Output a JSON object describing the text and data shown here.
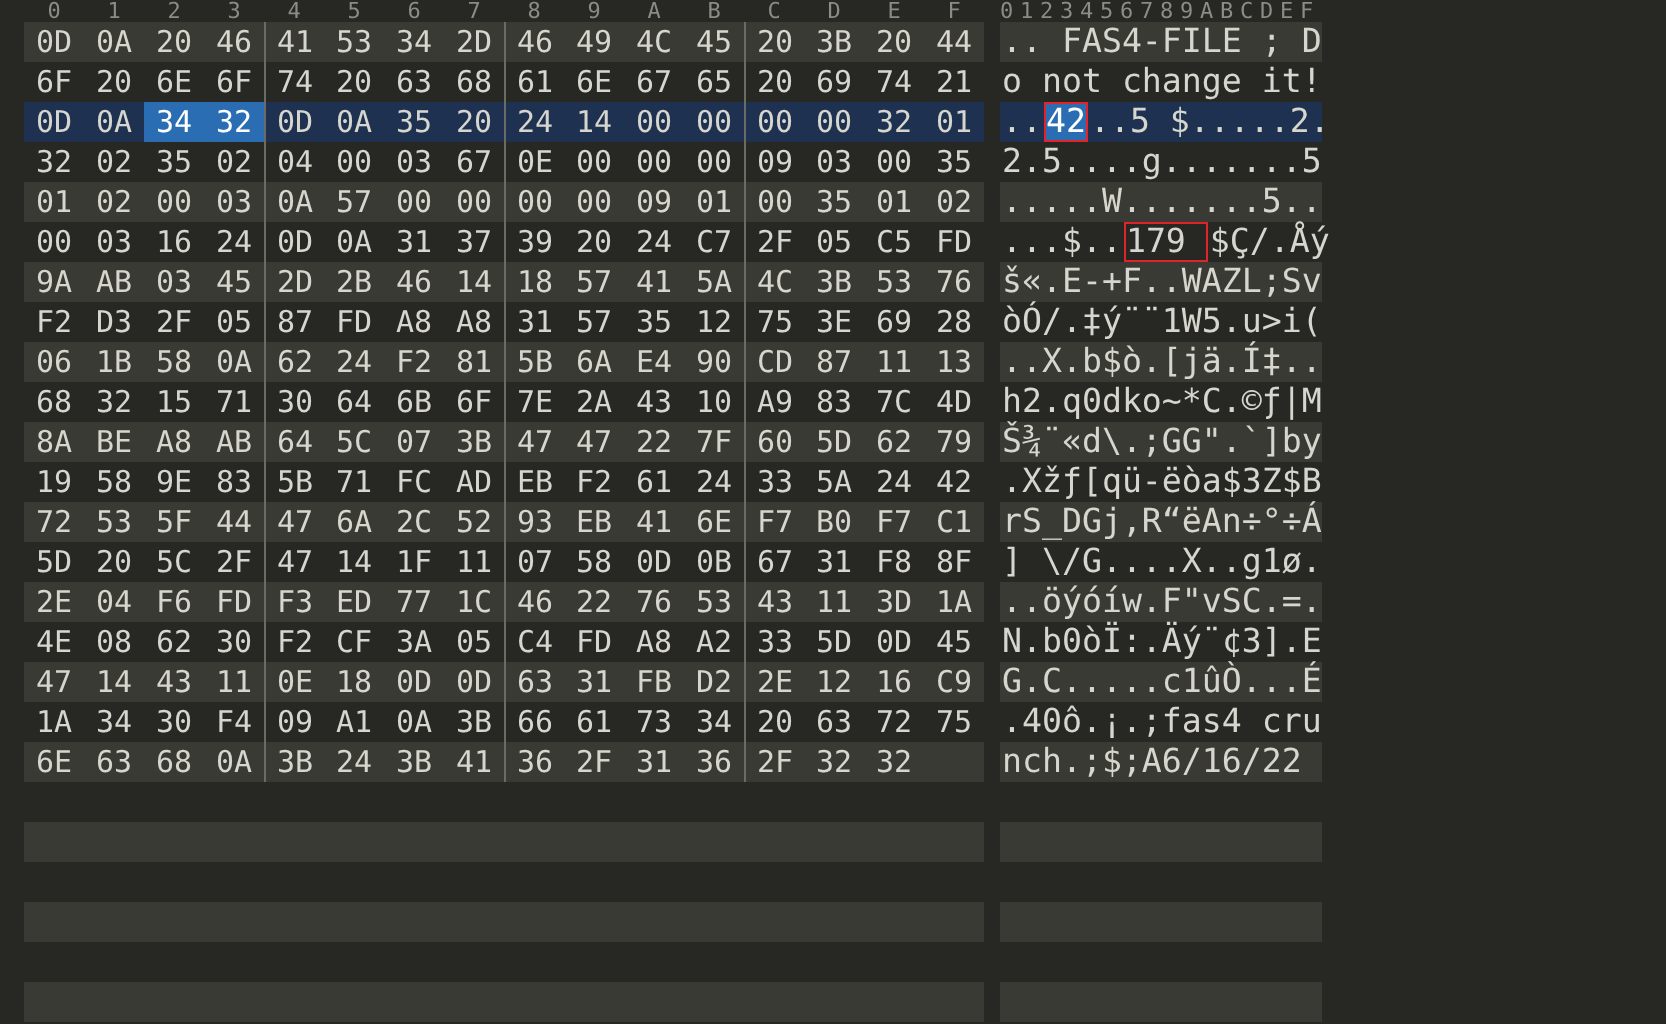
{
  "columns": [
    "0",
    "1",
    "2",
    "3",
    "4",
    "5",
    "6",
    "7",
    "8",
    "9",
    "A",
    "B",
    "C",
    "D",
    "E",
    "F"
  ],
  "ascii_header": "0123456789ABCDEF",
  "rows": [
    {
      "current": false,
      "bytes": [
        {
          "text": "0D",
          "selected": false
        },
        {
          "text": "0A",
          "selected": false
        },
        {
          "text": "20",
          "selected": false
        },
        {
          "text": "46",
          "selected": false
        },
        {
          "text": "41",
          "selected": false
        },
        {
          "text": "53",
          "selected": false
        },
        {
          "text": "34",
          "selected": false
        },
        {
          "text": "2D",
          "selected": false
        },
        {
          "text": "46",
          "selected": false
        },
        {
          "text": "49",
          "selected": false
        },
        {
          "text": "4C",
          "selected": false
        },
        {
          "text": "45",
          "selected": false
        },
        {
          "text": "20",
          "selected": false
        },
        {
          "text": "3B",
          "selected": false
        },
        {
          "text": "20",
          "selected": false
        },
        {
          "text": "44",
          "selected": false
        }
      ],
      "ascii": [
        {
          "text": ".. FAS4-FILE ; D",
          "selected": false,
          "boxed": false
        }
      ]
    },
    {
      "current": false,
      "bytes": [
        {
          "text": "6F",
          "selected": false
        },
        {
          "text": "20",
          "selected": false
        },
        {
          "text": "6E",
          "selected": false
        },
        {
          "text": "6F",
          "selected": false
        },
        {
          "text": "74",
          "selected": false
        },
        {
          "text": "20",
          "selected": false
        },
        {
          "text": "63",
          "selected": false
        },
        {
          "text": "68",
          "selected": false
        },
        {
          "text": "61",
          "selected": false
        },
        {
          "text": "6E",
          "selected": false
        },
        {
          "text": "67",
          "selected": false
        },
        {
          "text": "65",
          "selected": false
        },
        {
          "text": "20",
          "selected": false
        },
        {
          "text": "69",
          "selected": false
        },
        {
          "text": "74",
          "selected": false
        },
        {
          "text": "21",
          "selected": false
        }
      ],
      "ascii": [
        {
          "text": "o not change it!",
          "selected": false,
          "boxed": false
        }
      ]
    },
    {
      "current": true,
      "bytes": [
        {
          "text": "0D",
          "selected": false
        },
        {
          "text": "0A",
          "selected": false
        },
        {
          "text": "34",
          "selected": true
        },
        {
          "text": "32",
          "selected": true
        },
        {
          "text": "0D",
          "selected": false
        },
        {
          "text": "0A",
          "selected": false
        },
        {
          "text": "35",
          "selected": false
        },
        {
          "text": "20",
          "selected": false
        },
        {
          "text": "24",
          "selected": false
        },
        {
          "text": "14",
          "selected": false
        },
        {
          "text": "00",
          "selected": false
        },
        {
          "text": "00",
          "selected": false
        },
        {
          "text": "00",
          "selected": false
        },
        {
          "text": "00",
          "selected": false
        },
        {
          "text": "32",
          "selected": false
        },
        {
          "text": "01",
          "selected": false
        }
      ],
      "ascii": [
        {
          "text": "..",
          "selected": false,
          "boxed": false
        },
        {
          "text": "42",
          "selected": true,
          "boxed": true
        },
        {
          "text": "..5 $.....2.",
          "selected": false,
          "boxed": false
        }
      ]
    },
    {
      "current": false,
      "bytes": [
        {
          "text": "32",
          "selected": false
        },
        {
          "text": "02",
          "selected": false
        },
        {
          "text": "35",
          "selected": false
        },
        {
          "text": "02",
          "selected": false
        },
        {
          "text": "04",
          "selected": false
        },
        {
          "text": "00",
          "selected": false
        },
        {
          "text": "03",
          "selected": false
        },
        {
          "text": "67",
          "selected": false
        },
        {
          "text": "0E",
          "selected": false
        },
        {
          "text": "00",
          "selected": false
        },
        {
          "text": "00",
          "selected": false
        },
        {
          "text": "00",
          "selected": false
        },
        {
          "text": "09",
          "selected": false
        },
        {
          "text": "03",
          "selected": false
        },
        {
          "text": "00",
          "selected": false
        },
        {
          "text": "35",
          "selected": false
        }
      ],
      "ascii": [
        {
          "text": "2.5....g.......5",
          "selected": false,
          "boxed": false
        }
      ]
    },
    {
      "current": false,
      "bytes": [
        {
          "text": "01",
          "selected": false
        },
        {
          "text": "02",
          "selected": false
        },
        {
          "text": "00",
          "selected": false
        },
        {
          "text": "03",
          "selected": false
        },
        {
          "text": "0A",
          "selected": false
        },
        {
          "text": "57",
          "selected": false
        },
        {
          "text": "00",
          "selected": false
        },
        {
          "text": "00",
          "selected": false
        },
        {
          "text": "00",
          "selected": false
        },
        {
          "text": "00",
          "selected": false
        },
        {
          "text": "09",
          "selected": false
        },
        {
          "text": "01",
          "selected": false
        },
        {
          "text": "00",
          "selected": false
        },
        {
          "text": "35",
          "selected": false
        },
        {
          "text": "01",
          "selected": false
        },
        {
          "text": "02",
          "selected": false
        }
      ],
      "ascii": [
        {
          "text": ".....W.......5..",
          "selected": false,
          "boxed": false
        }
      ]
    },
    {
      "current": false,
      "bytes": [
        {
          "text": "00",
          "selected": false
        },
        {
          "text": "03",
          "selected": false
        },
        {
          "text": "16",
          "selected": false
        },
        {
          "text": "24",
          "selected": false
        },
        {
          "text": "0D",
          "selected": false
        },
        {
          "text": "0A",
          "selected": false
        },
        {
          "text": "31",
          "selected": false
        },
        {
          "text": "37",
          "selected": false
        },
        {
          "text": "39",
          "selected": false
        },
        {
          "text": "20",
          "selected": false
        },
        {
          "text": "24",
          "selected": false
        },
        {
          "text": "C7",
          "selected": false
        },
        {
          "text": "2F",
          "selected": false
        },
        {
          "text": "05",
          "selected": false
        },
        {
          "text": "C5",
          "selected": false
        },
        {
          "text": "FD",
          "selected": false
        }
      ],
      "ascii": [
        {
          "text": "...$..",
          "selected": false,
          "boxed": false
        },
        {
          "text": "179 ",
          "selected": false,
          "boxed": true
        },
        {
          "text": "$Ç/.Åý",
          "selected": false,
          "boxed": false
        }
      ]
    },
    {
      "current": false,
      "bytes": [
        {
          "text": "9A",
          "selected": false
        },
        {
          "text": "AB",
          "selected": false
        },
        {
          "text": "03",
          "selected": false
        },
        {
          "text": "45",
          "selected": false
        },
        {
          "text": "2D",
          "selected": false
        },
        {
          "text": "2B",
          "selected": false
        },
        {
          "text": "46",
          "selected": false
        },
        {
          "text": "14",
          "selected": false
        },
        {
          "text": "18",
          "selected": false
        },
        {
          "text": "57",
          "selected": false
        },
        {
          "text": "41",
          "selected": false
        },
        {
          "text": "5A",
          "selected": false
        },
        {
          "text": "4C",
          "selected": false
        },
        {
          "text": "3B",
          "selected": false
        },
        {
          "text": "53",
          "selected": false
        },
        {
          "text": "76",
          "selected": false
        }
      ],
      "ascii": [
        {
          "text": "š«.E-+F..WAZL;Sv",
          "selected": false,
          "boxed": false
        }
      ]
    },
    {
      "current": false,
      "bytes": [
        {
          "text": "F2",
          "selected": false
        },
        {
          "text": "D3",
          "selected": false
        },
        {
          "text": "2F",
          "selected": false
        },
        {
          "text": "05",
          "selected": false
        },
        {
          "text": "87",
          "selected": false
        },
        {
          "text": "FD",
          "selected": false
        },
        {
          "text": "A8",
          "selected": false
        },
        {
          "text": "A8",
          "selected": false
        },
        {
          "text": "31",
          "selected": false
        },
        {
          "text": "57",
          "selected": false
        },
        {
          "text": "35",
          "selected": false
        },
        {
          "text": "12",
          "selected": false
        },
        {
          "text": "75",
          "selected": false
        },
        {
          "text": "3E",
          "selected": false
        },
        {
          "text": "69",
          "selected": false
        },
        {
          "text": "28",
          "selected": false
        }
      ],
      "ascii": [
        {
          "text": "òÓ/.‡ý¨¨1W5.u>i(",
          "selected": false,
          "boxed": false
        }
      ]
    },
    {
      "current": false,
      "bytes": [
        {
          "text": "06",
          "selected": false
        },
        {
          "text": "1B",
          "selected": false
        },
        {
          "text": "58",
          "selected": false
        },
        {
          "text": "0A",
          "selected": false
        },
        {
          "text": "62",
          "selected": false
        },
        {
          "text": "24",
          "selected": false
        },
        {
          "text": "F2",
          "selected": false
        },
        {
          "text": "81",
          "selected": false
        },
        {
          "text": "5B",
          "selected": false
        },
        {
          "text": "6A",
          "selected": false
        },
        {
          "text": "E4",
          "selected": false
        },
        {
          "text": "90",
          "selected": false
        },
        {
          "text": "CD",
          "selected": false
        },
        {
          "text": "87",
          "selected": false
        },
        {
          "text": "11",
          "selected": false
        },
        {
          "text": "13",
          "selected": false
        }
      ],
      "ascii": [
        {
          "text": "..X.b$ò.[jä.Í‡..",
          "selected": false,
          "boxed": false
        }
      ]
    },
    {
      "current": false,
      "bytes": [
        {
          "text": "68",
          "selected": false
        },
        {
          "text": "32",
          "selected": false
        },
        {
          "text": "15",
          "selected": false
        },
        {
          "text": "71",
          "selected": false
        },
        {
          "text": "30",
          "selected": false
        },
        {
          "text": "64",
          "selected": false
        },
        {
          "text": "6B",
          "selected": false
        },
        {
          "text": "6F",
          "selected": false
        },
        {
          "text": "7E",
          "selected": false
        },
        {
          "text": "2A",
          "selected": false
        },
        {
          "text": "43",
          "selected": false
        },
        {
          "text": "10",
          "selected": false
        },
        {
          "text": "A9",
          "selected": false
        },
        {
          "text": "83",
          "selected": false
        },
        {
          "text": "7C",
          "selected": false
        },
        {
          "text": "4D",
          "selected": false
        }
      ],
      "ascii": [
        {
          "text": "h2.q0dko~*C.©ƒ|M",
          "selected": false,
          "boxed": false
        }
      ]
    },
    {
      "current": false,
      "bytes": [
        {
          "text": "8A",
          "selected": false
        },
        {
          "text": "BE",
          "selected": false
        },
        {
          "text": "A8",
          "selected": false
        },
        {
          "text": "AB",
          "selected": false
        },
        {
          "text": "64",
          "selected": false
        },
        {
          "text": "5C",
          "selected": false
        },
        {
          "text": "07",
          "selected": false
        },
        {
          "text": "3B",
          "selected": false
        },
        {
          "text": "47",
          "selected": false
        },
        {
          "text": "47",
          "selected": false
        },
        {
          "text": "22",
          "selected": false
        },
        {
          "text": "7F",
          "selected": false
        },
        {
          "text": "60",
          "selected": false
        },
        {
          "text": "5D",
          "selected": false
        },
        {
          "text": "62",
          "selected": false
        },
        {
          "text": "79",
          "selected": false
        }
      ],
      "ascii": [
        {
          "text": "Š¾¨«d\\.;GG\".`]by",
          "selected": false,
          "boxed": false
        }
      ]
    },
    {
      "current": false,
      "bytes": [
        {
          "text": "19",
          "selected": false
        },
        {
          "text": "58",
          "selected": false
        },
        {
          "text": "9E",
          "selected": false
        },
        {
          "text": "83",
          "selected": false
        },
        {
          "text": "5B",
          "selected": false
        },
        {
          "text": "71",
          "selected": false
        },
        {
          "text": "FC",
          "selected": false
        },
        {
          "text": "AD",
          "selected": false
        },
        {
          "text": "EB",
          "selected": false
        },
        {
          "text": "F2",
          "selected": false
        },
        {
          "text": "61",
          "selected": false
        },
        {
          "text": "24",
          "selected": false
        },
        {
          "text": "33",
          "selected": false
        },
        {
          "text": "5A",
          "selected": false
        },
        {
          "text": "24",
          "selected": false
        },
        {
          "text": "42",
          "selected": false
        }
      ],
      "ascii": [
        {
          "text": ".Xžƒ[qü-ëòa$3Z$B",
          "selected": false,
          "boxed": false
        }
      ]
    },
    {
      "current": false,
      "bytes": [
        {
          "text": "72",
          "selected": false
        },
        {
          "text": "53",
          "selected": false
        },
        {
          "text": "5F",
          "selected": false
        },
        {
          "text": "44",
          "selected": false
        },
        {
          "text": "47",
          "selected": false
        },
        {
          "text": "6A",
          "selected": false
        },
        {
          "text": "2C",
          "selected": false
        },
        {
          "text": "52",
          "selected": false
        },
        {
          "text": "93",
          "selected": false
        },
        {
          "text": "EB",
          "selected": false
        },
        {
          "text": "41",
          "selected": false
        },
        {
          "text": "6E",
          "selected": false
        },
        {
          "text": "F7",
          "selected": false
        },
        {
          "text": "B0",
          "selected": false
        },
        {
          "text": "F7",
          "selected": false
        },
        {
          "text": "C1",
          "selected": false
        }
      ],
      "ascii": [
        {
          "text": "rS_DGj,R“ëAn÷°÷Á",
          "selected": false,
          "boxed": false
        }
      ]
    },
    {
      "current": false,
      "bytes": [
        {
          "text": "5D",
          "selected": false
        },
        {
          "text": "20",
          "selected": false
        },
        {
          "text": "5C",
          "selected": false
        },
        {
          "text": "2F",
          "selected": false
        },
        {
          "text": "47",
          "selected": false
        },
        {
          "text": "14",
          "selected": false
        },
        {
          "text": "1F",
          "selected": false
        },
        {
          "text": "11",
          "selected": false
        },
        {
          "text": "07",
          "selected": false
        },
        {
          "text": "58",
          "selected": false
        },
        {
          "text": "0D",
          "selected": false
        },
        {
          "text": "0B",
          "selected": false
        },
        {
          "text": "67",
          "selected": false
        },
        {
          "text": "31",
          "selected": false
        },
        {
          "text": "F8",
          "selected": false
        },
        {
          "text": "8F",
          "selected": false
        }
      ],
      "ascii": [
        {
          "text": "] \\/G....X..g1ø.",
          "selected": false,
          "boxed": false
        }
      ]
    },
    {
      "current": false,
      "bytes": [
        {
          "text": "2E",
          "selected": false
        },
        {
          "text": "04",
          "selected": false
        },
        {
          "text": "F6",
          "selected": false
        },
        {
          "text": "FD",
          "selected": false
        },
        {
          "text": "F3",
          "selected": false
        },
        {
          "text": "ED",
          "selected": false
        },
        {
          "text": "77",
          "selected": false
        },
        {
          "text": "1C",
          "selected": false
        },
        {
          "text": "46",
          "selected": false
        },
        {
          "text": "22",
          "selected": false
        },
        {
          "text": "76",
          "selected": false
        },
        {
          "text": "53",
          "selected": false
        },
        {
          "text": "43",
          "selected": false
        },
        {
          "text": "11",
          "selected": false
        },
        {
          "text": "3D",
          "selected": false
        },
        {
          "text": "1A",
          "selected": false
        }
      ],
      "ascii": [
        {
          "text": "..öýóíw.F\"vSC.=.",
          "selected": false,
          "boxed": false
        }
      ]
    },
    {
      "current": false,
      "bytes": [
        {
          "text": "4E",
          "selected": false
        },
        {
          "text": "08",
          "selected": false
        },
        {
          "text": "62",
          "selected": false
        },
        {
          "text": "30",
          "selected": false
        },
        {
          "text": "F2",
          "selected": false
        },
        {
          "text": "CF",
          "selected": false
        },
        {
          "text": "3A",
          "selected": false
        },
        {
          "text": "05",
          "selected": false
        },
        {
          "text": "C4",
          "selected": false
        },
        {
          "text": "FD",
          "selected": false
        },
        {
          "text": "A8",
          "selected": false
        },
        {
          "text": "A2",
          "selected": false
        },
        {
          "text": "33",
          "selected": false
        },
        {
          "text": "5D",
          "selected": false
        },
        {
          "text": "0D",
          "selected": false
        },
        {
          "text": "45",
          "selected": false
        }
      ],
      "ascii": [
        {
          "text": "N.b0òÏ:.Äý¨¢3].E",
          "selected": false,
          "boxed": false
        }
      ]
    },
    {
      "current": false,
      "bytes": [
        {
          "text": "47",
          "selected": false
        },
        {
          "text": "14",
          "selected": false
        },
        {
          "text": "43",
          "selected": false
        },
        {
          "text": "11",
          "selected": false
        },
        {
          "text": "0E",
          "selected": false
        },
        {
          "text": "18",
          "selected": false
        },
        {
          "text": "0D",
          "selected": false
        },
        {
          "text": "0D",
          "selected": false
        },
        {
          "text": "63",
          "selected": false
        },
        {
          "text": "31",
          "selected": false
        },
        {
          "text": "FB",
          "selected": false
        },
        {
          "text": "D2",
          "selected": false
        },
        {
          "text": "2E",
          "selected": false
        },
        {
          "text": "12",
          "selected": false
        },
        {
          "text": "16",
          "selected": false
        },
        {
          "text": "C9",
          "selected": false
        }
      ],
      "ascii": [
        {
          "text": "G.C.....c1ûÒ...É",
          "selected": false,
          "boxed": false
        }
      ]
    },
    {
      "current": false,
      "bytes": [
        {
          "text": "1A",
          "selected": false
        },
        {
          "text": "34",
          "selected": false
        },
        {
          "text": "30",
          "selected": false
        },
        {
          "text": "F4",
          "selected": false
        },
        {
          "text": "09",
          "selected": false
        },
        {
          "text": "A1",
          "selected": false
        },
        {
          "text": "0A",
          "selected": false
        },
        {
          "text": "3B",
          "selected": false
        },
        {
          "text": "66",
          "selected": false
        },
        {
          "text": "61",
          "selected": false
        },
        {
          "text": "73",
          "selected": false
        },
        {
          "text": "34",
          "selected": false
        },
        {
          "text": "20",
          "selected": false
        },
        {
          "text": "63",
          "selected": false
        },
        {
          "text": "72",
          "selected": false
        },
        {
          "text": "75",
          "selected": false
        }
      ],
      "ascii": [
        {
          "text": ".40ô.¡.;fas4 cru",
          "selected": false,
          "boxed": false
        }
      ]
    },
    {
      "current": false,
      "bytes": [
        {
          "text": "6E",
          "selected": false
        },
        {
          "text": "63",
          "selected": false
        },
        {
          "text": "68",
          "selected": false
        },
        {
          "text": "0A",
          "selected": false
        },
        {
          "text": "3B",
          "selected": false
        },
        {
          "text": "24",
          "selected": false
        },
        {
          "text": "3B",
          "selected": false
        },
        {
          "text": "41",
          "selected": false
        },
        {
          "text": "36",
          "selected": false
        },
        {
          "text": "2F",
          "selected": false
        },
        {
          "text": "31",
          "selected": false
        },
        {
          "text": "36",
          "selected": false
        },
        {
          "text": "2F",
          "selected": false
        },
        {
          "text": "32",
          "selected": false
        },
        {
          "text": "32",
          "selected": false
        }
      ],
      "ascii": [
        {
          "text": "nch.;$;A6/16/22",
          "selected": false,
          "boxed": false
        }
      ]
    }
  ]
}
